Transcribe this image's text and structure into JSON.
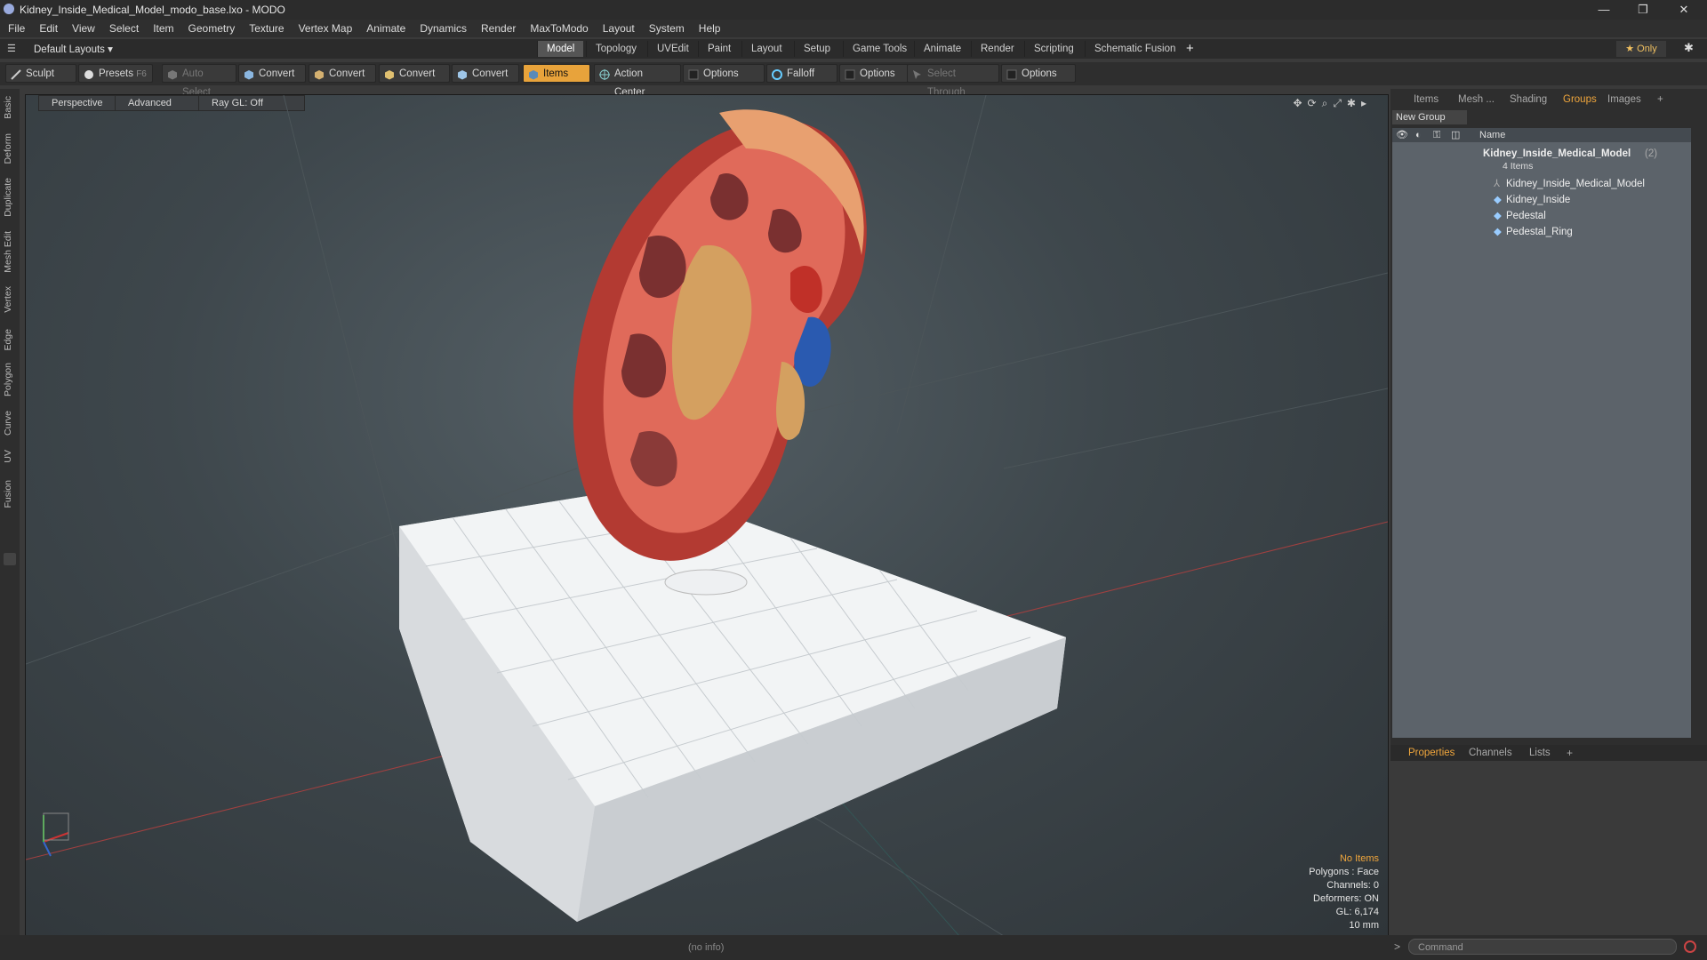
{
  "window": {
    "title": "Kidney_Inside_Medical_Model_modo_base.lxo - MODO",
    "minimize": "—",
    "maximize": "❐",
    "close": "✕"
  },
  "menu": [
    "File",
    "Edit",
    "View",
    "Select",
    "Item",
    "Geometry",
    "Texture",
    "Vertex Map",
    "Animate",
    "Dynamics",
    "Render",
    "MaxToModo",
    "Layout",
    "System",
    "Help"
  ],
  "layout_bar": {
    "layouts_label": "Default Layouts ▾",
    "tabs": [
      "Model",
      "Topology",
      "UVEdit",
      "Paint",
      "Layout",
      "Setup",
      "Game Tools",
      "Animate",
      "Render",
      "Scripting",
      "Schematic Fusion"
    ],
    "active_tab": "Model",
    "add": "+",
    "only_label": "★ Only",
    "gear": "✱"
  },
  "toolbar": {
    "sculpt": "Sculpt",
    "presets": "Presets",
    "presets_key": "F6",
    "auto_select": "Auto Select",
    "convert1": "Convert",
    "convert2": "Convert",
    "convert3": "Convert",
    "convert4": "Convert",
    "items": "Items",
    "action_center": "Action Center",
    "options1": "Options",
    "falloff": "Falloff",
    "options2": "Options",
    "select_through": "Select Through",
    "options3": "Options"
  },
  "left_tabs": [
    "Basic",
    "Deform",
    "Duplicate",
    "Mesh Edit",
    "Vertex",
    "Edge",
    "Polygon",
    "Curve",
    "UV",
    "Fusion"
  ],
  "viewport": {
    "view_mode": "Perspective",
    "shading": "Advanced",
    "raygl": "Ray GL: Off",
    "info": {
      "no_items": "No Items",
      "polygons": "Polygons : Face",
      "channels": "Channels: 0",
      "deformers": "Deformers: ON",
      "gl": "GL: 6,174",
      "unit": "10 mm"
    }
  },
  "right_panel": {
    "tabs": [
      "Items",
      "Mesh ...",
      "Shading",
      "Groups",
      "Images",
      "+"
    ],
    "active_tab": "Groups",
    "new_group": "New Group",
    "column_name": "Name",
    "group": {
      "name": "Kidney_Inside_Medical_Model",
      "count_suffix": "(2)",
      "sub": "4 Items"
    },
    "items": [
      "Kidney_Inside_Medical_Model",
      "Kidney_Inside",
      "Pedestal",
      "Pedestal_Ring"
    ]
  },
  "props_panel": {
    "tabs": [
      "Properties",
      "Channels",
      "Lists",
      "+"
    ],
    "active_tab": "Properties"
  },
  "status": {
    "info": "(no info)",
    "command_placeholder": "Command",
    "prompt": ">"
  },
  "colors": {
    "accent": "#e8a33b",
    "viewport_bg": "#3e474c",
    "tree_bg": "#5c636a"
  }
}
